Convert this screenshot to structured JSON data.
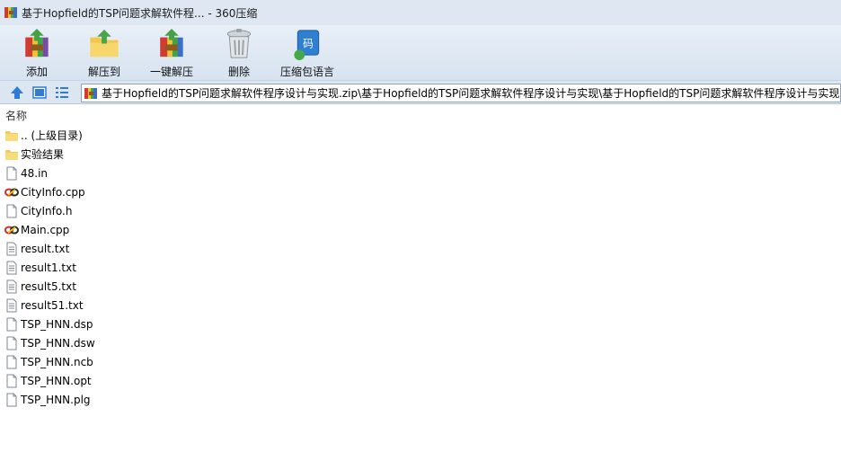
{
  "window": {
    "title": "基于Hopfield的TSP问题求解软件程... - 360压缩"
  },
  "toolbar": {
    "buttons": [
      {
        "label": "添加",
        "icon": "add-archive-icon"
      },
      {
        "label": "解压到",
        "icon": "extract-to-icon"
      },
      {
        "label": "一键解压",
        "icon": "one-click-extract-icon"
      },
      {
        "label": "删除",
        "icon": "delete-icon"
      },
      {
        "label": "压缩包语言",
        "icon": "archive-language-icon"
      }
    ]
  },
  "address": {
    "path": "基于Hopfield的TSP问题求解软件程序设计与实现.zip\\基于Hopfield的TSP问题求解软件程序设计与实现\\基于Hopfield的TSP问题求解软件程序设计与实现"
  },
  "list": {
    "column_name": "名称",
    "items": [
      {
        "name": ".. (上级目录)",
        "type": "folder"
      },
      {
        "name": "实验结果",
        "type": "folder"
      },
      {
        "name": "48.in",
        "type": "file"
      },
      {
        "name": "CityInfo.cpp",
        "type": "cpp"
      },
      {
        "name": "CityInfo.h",
        "type": "file"
      },
      {
        "name": "Main.cpp",
        "type": "cpp"
      },
      {
        "name": "result.txt",
        "type": "txt"
      },
      {
        "name": "result1.txt",
        "type": "txt"
      },
      {
        "name": "result5.txt",
        "type": "txt"
      },
      {
        "name": "result51.txt",
        "type": "txt"
      },
      {
        "name": "TSP_HNN.dsp",
        "type": "file"
      },
      {
        "name": "TSP_HNN.dsw",
        "type": "file"
      },
      {
        "name": "TSP_HNN.ncb",
        "type": "file"
      },
      {
        "name": "TSP_HNN.opt",
        "type": "file"
      },
      {
        "name": "TSP_HNN.plg",
        "type": "file"
      }
    ]
  }
}
